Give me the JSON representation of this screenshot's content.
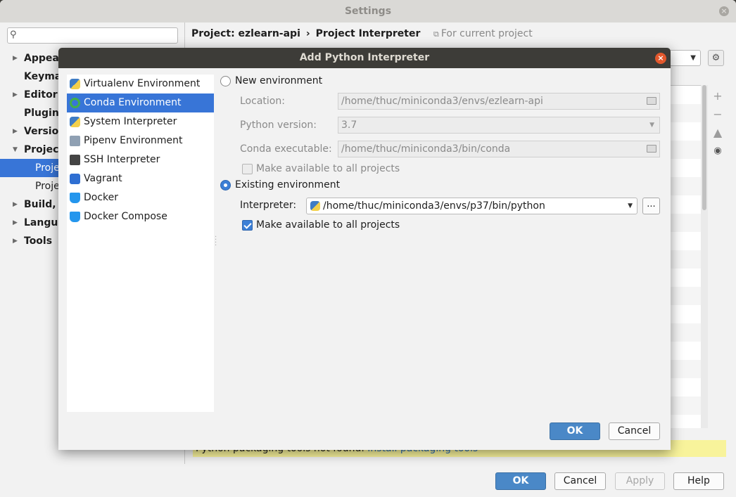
{
  "settings": {
    "title": "Settings",
    "search_placeholder": "",
    "sidebar": [
      {
        "label": "Appearance & Behavior",
        "arrow": "▶"
      },
      {
        "label": "Keymap",
        "arrow": ""
      },
      {
        "label": "Editor",
        "arrow": "▶"
      },
      {
        "label": "Plugins",
        "arrow": ""
      },
      {
        "label": "Version Control",
        "arrow": "▶"
      },
      {
        "label": "Project: ezlearn-api",
        "arrow": "▼"
      },
      {
        "label": "Project Interpreter",
        "arrow": ""
      },
      {
        "label": "Project Structure",
        "arrow": ""
      },
      {
        "label": "Build, Execution, Deployment",
        "arrow": "▶"
      },
      {
        "label": "Languages & Frameworks",
        "arrow": "▶"
      },
      {
        "label": "Tools",
        "arrow": "▶"
      }
    ],
    "breadcrumb": {
      "project": "Project: ezlearn-api",
      "separator": "›",
      "page": "Project Interpreter"
    },
    "for_current_project": "For current project",
    "side_tools": {
      "add": "+",
      "remove": "−",
      "up": "▲",
      "eye": "◉"
    },
    "warning": {
      "text": "Python packaging tools not found.",
      "link": "Install packaging tools"
    },
    "buttons": {
      "ok": "OK",
      "cancel": "Cancel",
      "apply": "Apply",
      "help": "Help"
    },
    "accent_color": "#3875d7",
    "warning_color": "#f8f39b"
  },
  "dialog": {
    "title": "Add Python Interpreter",
    "environments": [
      {
        "label": "Virtualenv Environment",
        "icon": "virtualenv-icon",
        "selected": false
      },
      {
        "label": "Conda Environment",
        "icon": "conda-icon",
        "selected": true
      },
      {
        "label": "System Interpreter",
        "icon": "python-icon",
        "selected": false
      },
      {
        "label": "Pipenv Environment",
        "icon": "pipenv-icon",
        "selected": false
      },
      {
        "label": "SSH Interpreter",
        "icon": "terminal-icon",
        "selected": false
      },
      {
        "label": "Vagrant",
        "icon": "vagrant-icon",
        "selected": false
      },
      {
        "label": "Docker",
        "icon": "docker-icon",
        "selected": false
      },
      {
        "label": "Docker Compose",
        "icon": "docker-compose-icon",
        "selected": false
      }
    ],
    "new_env": {
      "label": "New environment",
      "checked": false,
      "location_label": "Location:",
      "location_value": "/home/thuc/miniconda3/envs/ezlearn-api",
      "python_version_label": "Python version:",
      "python_version_value": "3.7",
      "conda_exec_label": "Conda executable:",
      "conda_exec_value": "/home/thuc/miniconda3/bin/conda",
      "make_available_label": "Make available to all projects",
      "make_available_checked": false
    },
    "existing_env": {
      "label": "Existing environment",
      "checked": true,
      "interpreter_label": "Interpreter:",
      "interpreter_value": "/home/thuc/miniconda3/envs/p37/bin/python",
      "browse_label": "...",
      "make_available_label": "Make available to all projects",
      "make_available_checked": true
    },
    "buttons": {
      "ok": "OK",
      "cancel": "Cancel"
    }
  }
}
